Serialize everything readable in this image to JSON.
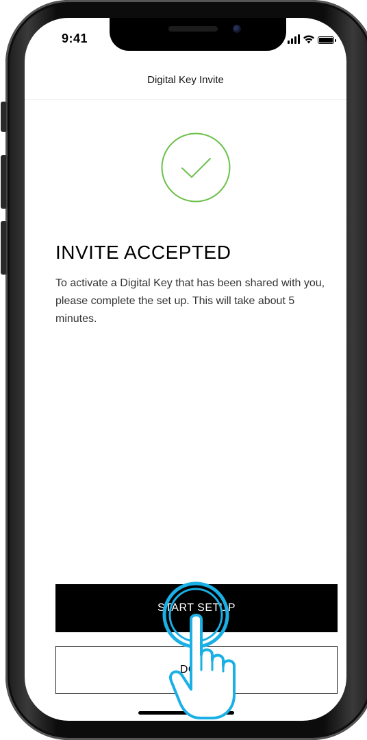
{
  "status_bar": {
    "time": "9:41",
    "icons": [
      "signal-icon",
      "wifi-icon",
      "battery-icon"
    ]
  },
  "nav": {
    "title": "Digital Key Invite"
  },
  "success_icon": "check-circle-icon",
  "main": {
    "heading": "INVITE ACCEPTED",
    "body": "To activate a Digital Key that has been shared with you, please complete the set up. This will take about 5 minutes."
  },
  "buttons": {
    "primary_label": "START SETUP",
    "secondary_label": "DONE"
  },
  "overlay": {
    "gesture_icon": "tap-hand-icon"
  },
  "colors": {
    "accent_green": "#6cc04a",
    "primary_button": "#000000",
    "tap_highlight": "#1ab0e6"
  }
}
